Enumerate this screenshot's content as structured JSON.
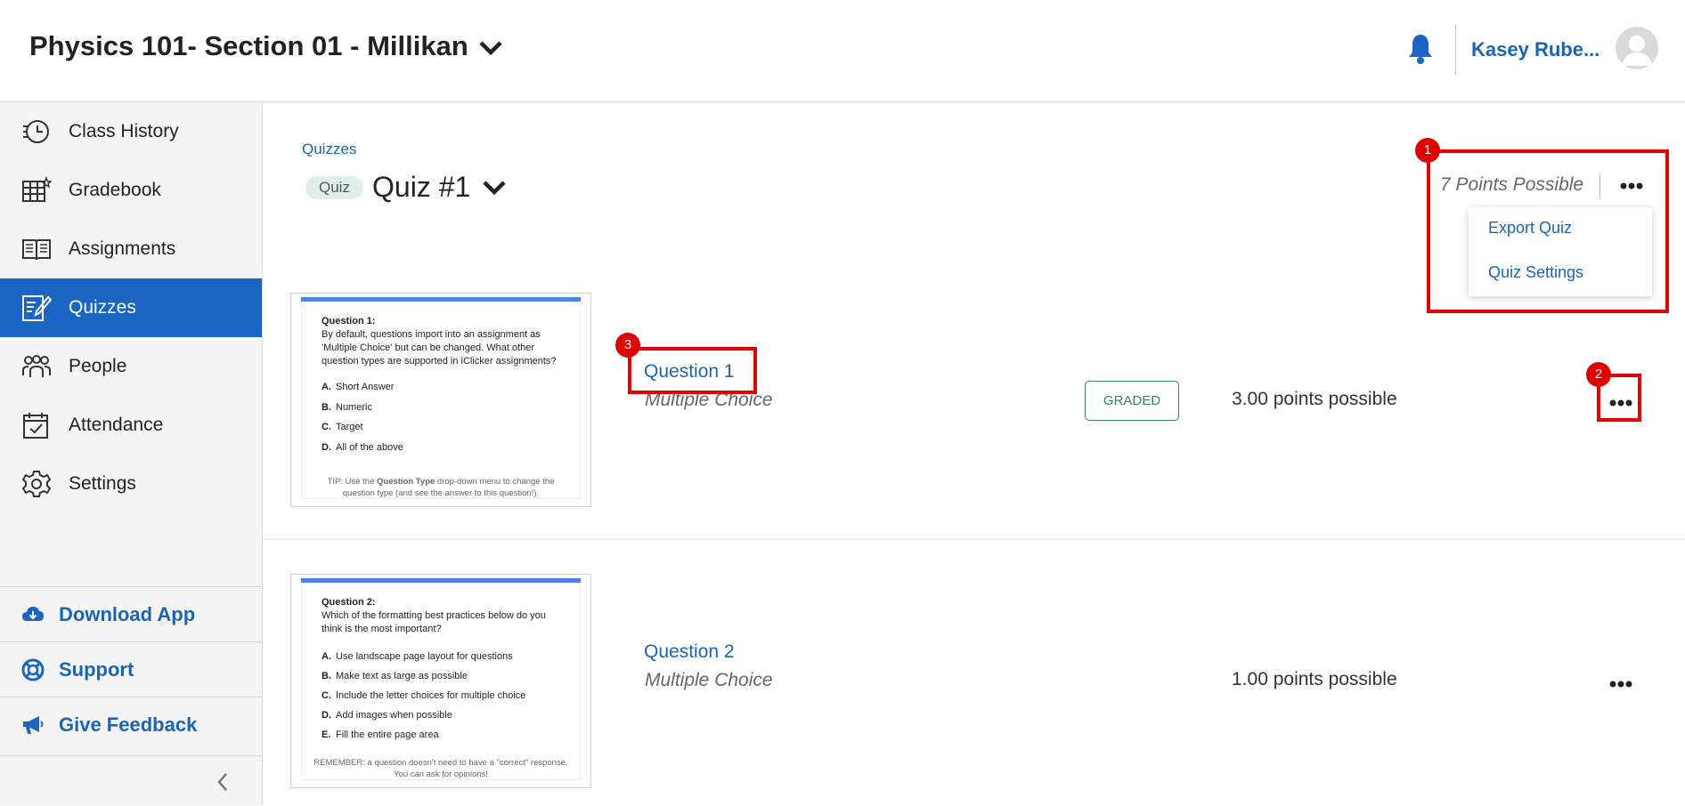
{
  "header": {
    "course_title": "Physics 101- Section 01 - Millikan",
    "user_name": "Kasey Rube..."
  },
  "sidebar": {
    "items": [
      {
        "label": "Class History",
        "icon": "class-history-icon"
      },
      {
        "label": "Gradebook",
        "icon": "gradebook-icon"
      },
      {
        "label": "Assignments",
        "icon": "assignments-icon"
      },
      {
        "label": "Quizzes",
        "icon": "quizzes-icon",
        "active": true
      },
      {
        "label": "People",
        "icon": "people-icon"
      },
      {
        "label": "Attendance",
        "icon": "attendance-icon"
      },
      {
        "label": "Settings",
        "icon": "settings-icon"
      }
    ],
    "bottom_links": [
      {
        "label": "Download App",
        "icon": "cloud-download-icon"
      },
      {
        "label": "Support",
        "icon": "lifebuoy-icon"
      },
      {
        "label": "Give Feedback",
        "icon": "megaphone-icon"
      }
    ]
  },
  "main": {
    "breadcrumb": "Quizzes",
    "tag": "Quiz",
    "title": "Quiz #1",
    "points_possible": "7 Points Possible",
    "menu": {
      "export": "Export Quiz",
      "settings": "Quiz Settings"
    },
    "questions": [
      {
        "title": "Question 1",
        "type": "Multiple Choice",
        "status": "GRADED",
        "points": "3.00 points possible",
        "thumb": {
          "heading": "Question 1:",
          "text": "By default, questions import into an assignment as 'Multiple Choice' but can be changed. What other question types are supported in iClicker assignments?",
          "options": [
            {
              "letter": "A.",
              "text": "Short Answer"
            },
            {
              "letter": "B.",
              "text": "Numeric"
            },
            {
              "letter": "C.",
              "text": "Target"
            },
            {
              "letter": "D.",
              "text": "All of the above"
            }
          ],
          "tip_prefix": "TIP: Use the ",
          "tip_bold": "Question Type",
          "tip_suffix": " drop-down menu to change the question type (and see the answer to this question!)."
        }
      },
      {
        "title": "Question 2",
        "type": "Multiple Choice",
        "points": "1.00 points possible",
        "thumb": {
          "heading": "Question 2:",
          "text": "Which of the formatting best practices below do you think is the most important?",
          "options": [
            {
              "letter": "A.",
              "text": "Use landscape page layout for questions"
            },
            {
              "letter": "B.",
              "text": "Make text as large as possible"
            },
            {
              "letter": "C.",
              "text": "Include the letter choices for multiple choice"
            },
            {
              "letter": "D.",
              "text": "Add images when possible"
            },
            {
              "letter": "E.",
              "text": "Fill the entire page area"
            }
          ],
          "tip": "REMEMBER: a question doesn't need to have a \"correct\" response. You can ask for opinions!"
        }
      }
    ]
  },
  "callouts": [
    "1",
    "2",
    "3"
  ],
  "colors": {
    "accent": "#1a65c4",
    "link": "#1a65b3",
    "callout": "#e00000",
    "graded": "#2f8a57"
  }
}
